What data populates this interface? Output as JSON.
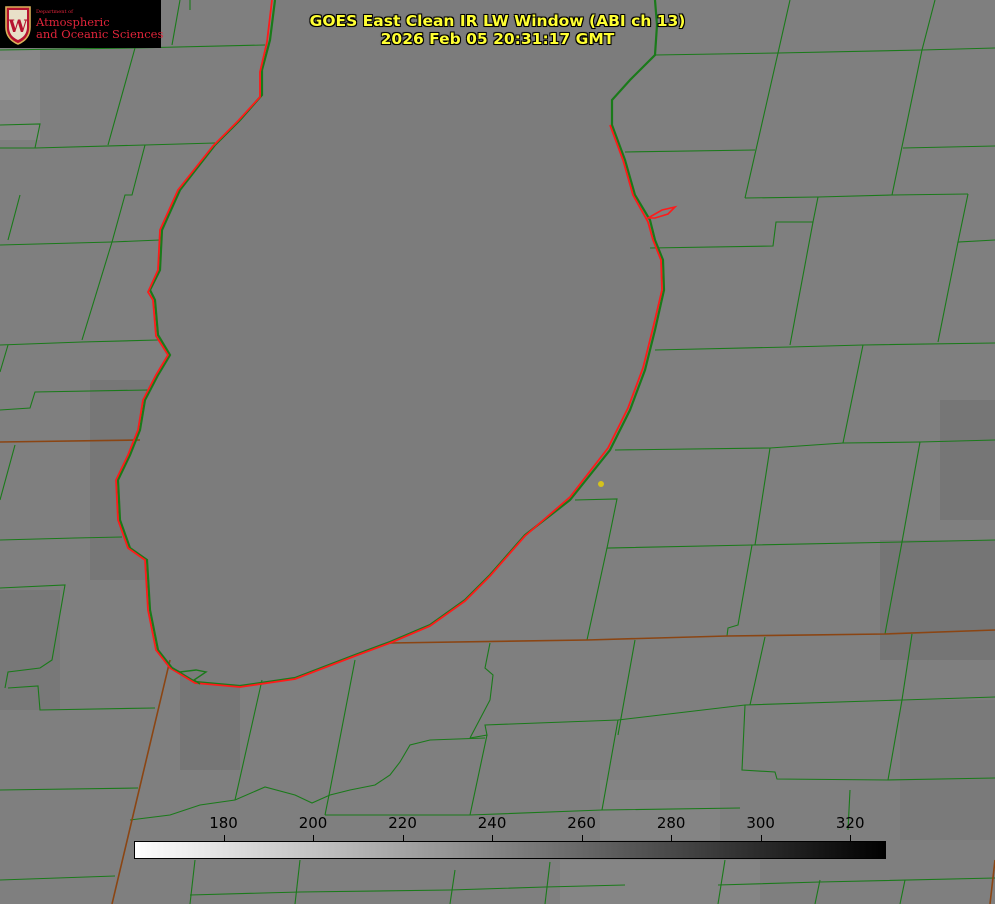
{
  "title": {
    "line1": "GOES East Clean IR LW Window (ABI ch 13)",
    "line2": "2026 Feb 05 20:31:17 GMT"
  },
  "logo": {
    "dept_small": "Department of",
    "line1": "Atmospheric",
    "line2": "and Oceanic Sciences",
    "seal_letter": "W",
    "brand_color": "#e0243a"
  },
  "colorbar": {
    "min": 160,
    "max": 328,
    "ticks": [
      "180",
      "200",
      "220",
      "240",
      "260",
      "280",
      "300",
      "320"
    ],
    "gradient_from": "#ffffff",
    "gradient_to": "#000000"
  },
  "colors": {
    "county_lines": "#1a7a1a",
    "state_lines": "#8b4513",
    "lake_shoreline": "#ff1a1a",
    "title_text": "#ffff33",
    "station_marker": "#d4c21c"
  }
}
